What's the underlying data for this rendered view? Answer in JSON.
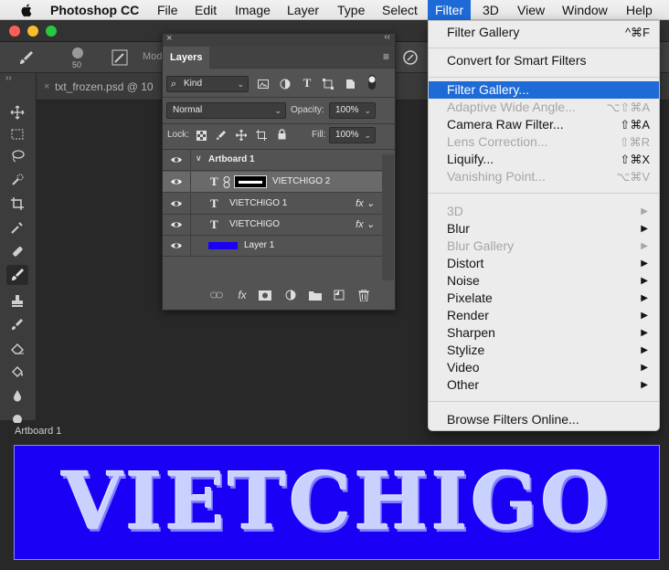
{
  "menubar": {
    "app_name": "Photoshop CC",
    "items": [
      "File",
      "Edit",
      "Image",
      "Layer",
      "Type",
      "Select",
      "Filter",
      "3D",
      "View",
      "Window",
      "Help"
    ],
    "active": "Filter"
  },
  "options_bar": {
    "brush_size": "50",
    "mode_label": "Mod"
  },
  "document": {
    "tab_title": "txt_frozen.psd @ 10"
  },
  "layers_panel": {
    "tab": "Layers",
    "kind_filter": "Kind",
    "blend_mode": "Normal",
    "opacity_label": "Opacity:",
    "opacity": "100%",
    "lock_label": "Lock:",
    "fill_label": "Fill:",
    "fill": "100%",
    "layers": [
      {
        "name": "Artboard 1",
        "kind": "artboard"
      },
      {
        "name": "VIETCHIGO 2",
        "kind": "text",
        "selected": true
      },
      {
        "name": "VIETCHIGO 1",
        "kind": "text",
        "fx": "fx"
      },
      {
        "name": "VIETCHIGO",
        "kind": "text",
        "fx": "fx"
      },
      {
        "name": "Layer 1",
        "kind": "fill",
        "swatch": "#1a00f5"
      }
    ]
  },
  "filter_menu": {
    "items": [
      {
        "label": "Filter Gallery",
        "shortcut": "^⌘F"
      },
      {
        "label": "Convert for Smart Filters"
      },
      {
        "label": "Filter Gallery...",
        "highlighted": true
      },
      {
        "label": "Adaptive Wide Angle...",
        "shortcut": "⌥⇧⌘A",
        "disabled": true
      },
      {
        "label": "Camera Raw Filter...",
        "shortcut": "⇧⌘A"
      },
      {
        "label": "Lens Correction...",
        "shortcut": "⇧⌘R",
        "disabled": true
      },
      {
        "label": "Liquify...",
        "shortcut": "⇧⌘X"
      },
      {
        "label": "Vanishing Point...",
        "shortcut": "⌥⌘V",
        "disabled": true
      },
      {
        "label": "3D",
        "submenu": true,
        "disabled": true
      },
      {
        "label": "Blur",
        "submenu": true
      },
      {
        "label": "Blur Gallery",
        "submenu": true,
        "disabled": true
      },
      {
        "label": "Distort",
        "submenu": true
      },
      {
        "label": "Noise",
        "submenu": true
      },
      {
        "label": "Pixelate",
        "submenu": true
      },
      {
        "label": "Render",
        "submenu": true
      },
      {
        "label": "Sharpen",
        "submenu": true
      },
      {
        "label": "Stylize",
        "submenu": true
      },
      {
        "label": "Video",
        "submenu": true
      },
      {
        "label": "Other",
        "submenu": true
      },
      {
        "label": "Browse Filters Online..."
      }
    ],
    "submenu_arrow": "▶"
  },
  "artboard": {
    "label": "Artboard 1",
    "text": "VIETCHIGO",
    "background": "#1a00f5"
  }
}
